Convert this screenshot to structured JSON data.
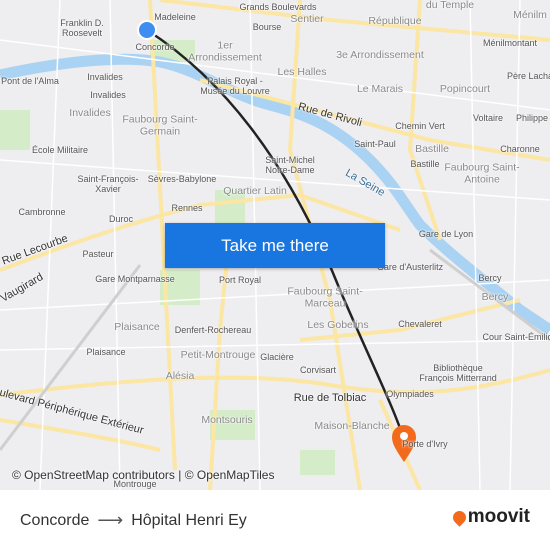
{
  "map": {
    "labels": [
      {
        "text": "Madeleine"
      },
      {
        "text": "Grands Boulevards"
      },
      {
        "text": "Sentier"
      },
      {
        "text": "République"
      },
      {
        "text": "du Temple"
      },
      {
        "text": "Ménilm"
      },
      {
        "text": "Franklin D. Roosevelt"
      },
      {
        "text": "Bourse"
      },
      {
        "text": "Concorde"
      },
      {
        "text": "1er Arrondissement"
      },
      {
        "text": "3e Arrondissement"
      },
      {
        "text": "Ménilmontant"
      },
      {
        "text": "Pont de l'Alma"
      },
      {
        "text": "Invalides"
      },
      {
        "text": "Palais Royal - Musée du Louvre"
      },
      {
        "text": "Les Halles"
      },
      {
        "text": "Père Lacha"
      },
      {
        "text": "Le Marais"
      },
      {
        "text": "Popincourt"
      },
      {
        "text": "Invalides"
      },
      {
        "text": "Invalides"
      },
      {
        "text": "Faubourg Saint-Germain"
      },
      {
        "text": "Rue de Rivoli"
      },
      {
        "text": "Chemin Vert"
      },
      {
        "text": "Voltaire"
      },
      {
        "text": "Philippe"
      },
      {
        "text": "Saint-Paul"
      },
      {
        "text": "Bastille"
      },
      {
        "text": "Charonne"
      },
      {
        "text": "École Militaire"
      },
      {
        "text": "Saint-Michel Notre-Dame"
      },
      {
        "text": "Bastille"
      },
      {
        "text": "Faubourg Saint-Antoine"
      },
      {
        "text": "La Seine"
      },
      {
        "text": "Saint-François-Xavier"
      },
      {
        "text": "Sèvres-Babylone"
      },
      {
        "text": "Quartier Latin"
      },
      {
        "text": "Cambronne"
      },
      {
        "text": "Duroc"
      },
      {
        "text": "Rennes"
      },
      {
        "text": "Gare de Lyon"
      },
      {
        "text": "Rue Lecourbe"
      },
      {
        "text": "Pasteur"
      },
      {
        "text": "Gare d'Austerlitz"
      },
      {
        "text": "Bercy"
      },
      {
        "text": "Gare Montparnasse"
      },
      {
        "text": "Port Royal"
      },
      {
        "text": "Faubourg Saint-Marceau"
      },
      {
        "text": "Bercy"
      },
      {
        "text": "Vaugirard"
      },
      {
        "text": "Plaisance"
      },
      {
        "text": "Denfert-Rochereau"
      },
      {
        "text": "Les Gobelins"
      },
      {
        "text": "Chevaleret"
      },
      {
        "text": "Cour Saint-Émilion"
      },
      {
        "text": "Plaisance"
      },
      {
        "text": "Petit-Montrouge"
      },
      {
        "text": "Glacière"
      },
      {
        "text": "Corvisart"
      },
      {
        "text": "Bibliothèque François Mitterrand"
      },
      {
        "text": "Alésia"
      },
      {
        "text": "Olympiades"
      },
      {
        "text": "Rue de Tolbiac"
      },
      {
        "text": "Boulevard Périphérique Extérieur"
      },
      {
        "text": "Montsouris"
      },
      {
        "text": "Maison-Blanche"
      },
      {
        "text": "Porte d'Ivry"
      },
      {
        "text": "Montrouge"
      }
    ],
    "attribution": "© OpenStreetMap contributors | © OpenMapTiles",
    "cta_label": "Take me there",
    "colors": {
      "route": "#222222",
      "origin": "#3d8ef0",
      "destination": "#f26b1d",
      "river": "#aad3f3",
      "button": "#1976e0"
    }
  },
  "footer": {
    "origin": "Concorde",
    "arrow": "⟶",
    "destination": "Hôpital Henri Ey",
    "brand": "moovit"
  }
}
